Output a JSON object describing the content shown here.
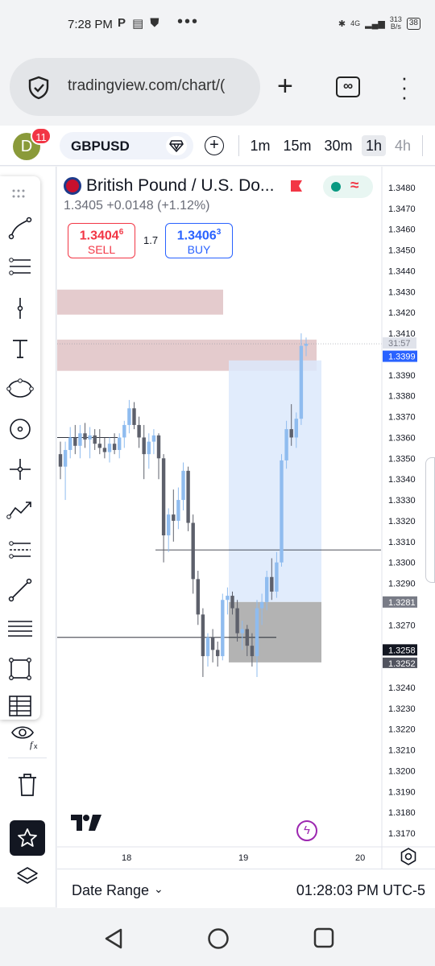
{
  "status_bar": {
    "time": "7:28 PM",
    "speed_value": "313",
    "speed_unit": "B/s",
    "battery": "38",
    "network": "4G"
  },
  "browser": {
    "url": "tradingview.com/chart/(",
    "icons": [
      "shield-icon",
      "plus-icon",
      "tabs-icon",
      "more-vertical-icon"
    ],
    "tabs_label": "∞"
  },
  "toolbar": {
    "avatar_letter": "D",
    "notification_count": "11",
    "symbol": "GBPUSD",
    "intervals": [
      "1m",
      "15m",
      "30m",
      "1h",
      "4h"
    ],
    "active_interval": "1h"
  },
  "legend": {
    "title": "British Pound / U.S. Do...",
    "last_price": "1.3405",
    "change": "+0.0148",
    "change_pct": "(+1.12%)",
    "sell": {
      "price_main": "1.3404",
      "price_sup": "6",
      "label": "SELL"
    },
    "spread": "1.7",
    "buy": {
      "price_main": "1.3406",
      "price_sup": "3",
      "label": "BUY"
    }
  },
  "price_scale": {
    "labels": [
      "1.3480",
      "1.3470",
      "1.3460",
      "1.3450",
      "1.3440",
      "1.3430",
      "1.3420",
      "1.3410",
      "1.3390",
      "1.3380",
      "1.3370",
      "1.3360",
      "1.3350",
      "1.3340",
      "1.3330",
      "1.3320",
      "1.3310",
      "1.3300",
      "1.3290",
      "1.3270",
      "1.3240",
      "1.3230",
      "1.3220",
      "1.3210",
      "1.3200",
      "1.3190",
      "1.3180",
      "1.3170"
    ],
    "countdown": "31:57",
    "current_price_tag": "1.3399",
    "tag_1": "1.3281",
    "tag_2": "1.3258",
    "tag_3": "1.3252",
    "colors": {
      "current_tag": "#2962ff",
      "grey_tag": "#787b86",
      "dark_tag": "#50535e"
    }
  },
  "time_scale": {
    "labels": [
      "18",
      "19",
      "20"
    ]
  },
  "bottom": {
    "date_range": "Date Range",
    "clock": "01:28:03 PM UTC-5"
  },
  "colors": {
    "bull": "#8fbcef",
    "bear": "#5d606b",
    "supply_zone": "#dbb9bc",
    "position_profit": "#dce9fb",
    "position_loss": "#a0a0a0",
    "sell": "#f23645",
    "buy": "#2962ff"
  },
  "chart_data": {
    "type": "candlestick",
    "symbol": "GBPUSD",
    "interval": "1h",
    "y_range": [
      1.3165,
      1.3485
    ],
    "candles": [
      [
        1.3352,
        1.3358,
        1.334,
        1.3346
      ],
      [
        1.3346,
        1.3358,
        1.333,
        1.3354
      ],
      [
        1.3354,
        1.3365,
        1.335,
        1.336
      ],
      [
        1.336,
        1.3366,
        1.3352,
        1.3356
      ],
      [
        1.3356,
        1.3366,
        1.335,
        1.3362
      ],
      [
        1.3362,
        1.3367,
        1.3355,
        1.3359
      ],
      [
        1.3359,
        1.3365,
        1.335,
        1.3361
      ],
      [
        1.3361,
        1.3364,
        1.3354,
        1.3357
      ],
      [
        1.3357,
        1.3364,
        1.3352,
        1.3355
      ],
      [
        1.3355,
        1.336,
        1.335,
        1.3353
      ],
      [
        1.3353,
        1.336,
        1.3348,
        1.3357
      ],
      [
        1.3357,
        1.3362,
        1.3352,
        1.3354
      ],
      [
        1.3354,
        1.3362,
        1.335,
        1.336
      ],
      [
        1.336,
        1.3368,
        1.3355,
        1.3366
      ],
      [
        1.3366,
        1.3378,
        1.3362,
        1.3374
      ],
      [
        1.3374,
        1.3377,
        1.3364,
        1.3366
      ],
      [
        1.3366,
        1.337,
        1.3355,
        1.336
      ],
      [
        1.336,
        1.3366,
        1.334,
        1.3352
      ],
      [
        1.3352,
        1.3362,
        1.3345,
        1.3358
      ],
      [
        1.3358,
        1.3364,
        1.3352,
        1.3361
      ],
      [
        1.3361,
        1.3362,
        1.334,
        1.335
      ],
      [
        1.335,
        1.3352,
        1.33,
        1.3313
      ],
      [
        1.3313,
        1.3326,
        1.3305,
        1.3323
      ],
      [
        1.3323,
        1.3335,
        1.331,
        1.332
      ],
      [
        1.332,
        1.3336,
        1.3316,
        1.333
      ],
      [
        1.333,
        1.3348,
        1.3325,
        1.3344
      ],
      [
        1.3344,
        1.3346,
        1.3315,
        1.3319
      ],
      [
        1.3319,
        1.3323,
        1.3285,
        1.3292
      ],
      [
        1.3292,
        1.3296,
        1.327,
        1.3275
      ],
      [
        1.3275,
        1.3278,
        1.3245,
        1.3255
      ],
      [
        1.3255,
        1.3266,
        1.325,
        1.3264
      ],
      [
        1.3264,
        1.3268,
        1.3252,
        1.3258
      ],
      [
        1.3258,
        1.3262,
        1.325,
        1.3255
      ],
      [
        1.3255,
        1.3285,
        1.3253,
        1.3282
      ],
      [
        1.3282,
        1.3288,
        1.3275,
        1.3284
      ],
      [
        1.3284,
        1.3286,
        1.3275,
        1.3278
      ],
      [
        1.3278,
        1.3282,
        1.3262,
        1.3266
      ],
      [
        1.3266,
        1.3272,
        1.3258,
        1.3268
      ],
      [
        1.3268,
        1.327,
        1.3255,
        1.326
      ],
      [
        1.326,
        1.3266,
        1.325,
        1.3255
      ],
      [
        1.3255,
        1.3282,
        1.3245,
        1.3278
      ],
      [
        1.3278,
        1.3285,
        1.327,
        1.3281
      ],
      [
        1.3281,
        1.3296,
        1.3277,
        1.3293
      ],
      [
        1.3293,
        1.3302,
        1.3282,
        1.3286
      ],
      [
        1.3286,
        1.3305,
        1.3283,
        1.33
      ],
      [
        1.33,
        1.3352,
        1.3298,
        1.3349
      ],
      [
        1.3349,
        1.3368,
        1.3345,
        1.3364
      ],
      [
        1.3364,
        1.3376,
        1.3356,
        1.336
      ],
      [
        1.336,
        1.3372,
        1.3355,
        1.3369
      ],
      [
        1.3369,
        1.341,
        1.3366,
        1.3404
      ],
      [
        1.3404,
        1.3408,
        1.3399,
        1.3405
      ]
    ],
    "zones": {
      "supply_upper": [
        1.3419,
        1.3431
      ],
      "supply_lower": [
        1.3392,
        1.3407
      ],
      "long_profit": [
        1.3281,
        1.3397
      ],
      "long_loss": [
        1.3252,
        1.3281
      ]
    },
    "horizontal_lines": [
      1.336,
      1.3306,
      1.3264
    ]
  }
}
